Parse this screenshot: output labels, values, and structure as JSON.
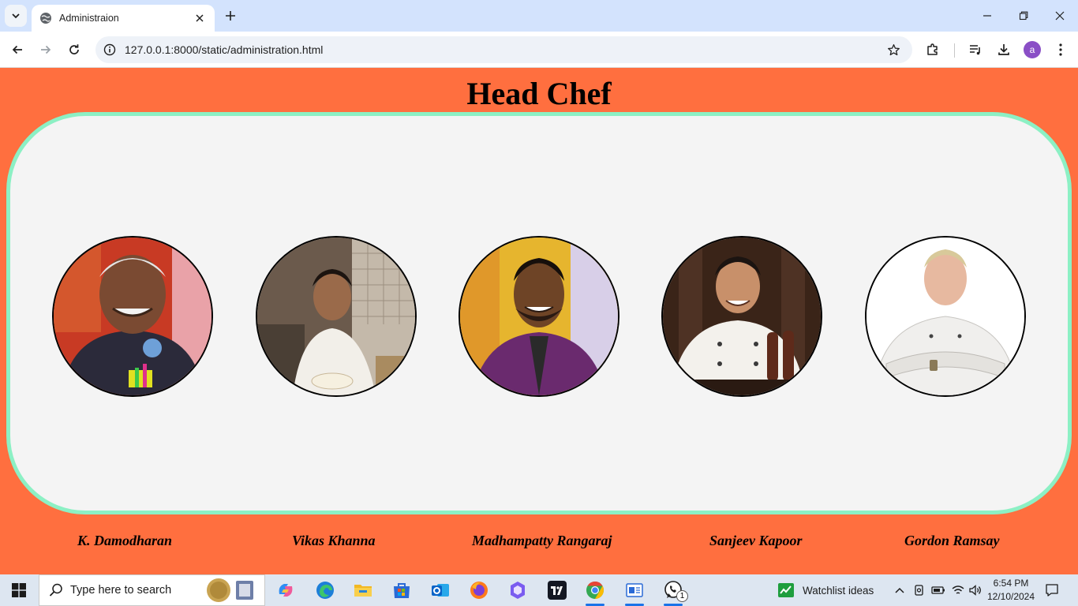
{
  "browser": {
    "tab_title": "Administraion",
    "url": "127.0.0.1:8000/static/administration.html",
    "profile_initial": "a"
  },
  "page": {
    "heading": "Head Chef",
    "chefs": [
      {
        "name": "K. Damodharan"
      },
      {
        "name": "Vikas Khanna"
      },
      {
        "name": "Madhampatty Rangaraj"
      },
      {
        "name": "Sanjeev Kapoor"
      },
      {
        "name": "Gordon Ramsay"
      }
    ]
  },
  "taskbar": {
    "search_placeholder": "Type here to search",
    "widget_label": "Watchlist ideas",
    "whatsapp_badge": "1",
    "time": "6:54 PM",
    "date": "12/10/2024"
  },
  "colors": {
    "page_background": "#ff6f3f",
    "panel_background": "#f4f4f4",
    "panel_border": "#8cf0c4"
  }
}
